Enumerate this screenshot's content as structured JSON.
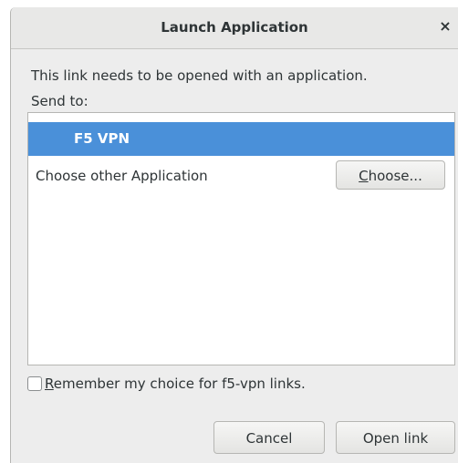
{
  "dialog": {
    "title": "Launch Application",
    "close_glyph": "×",
    "message": "This link needs to be opened with an application.",
    "send_to_label": "Send to:"
  },
  "app_list": {
    "selected_app": "F5 VPN",
    "other_label": "Choose other Application",
    "choose_button": {
      "mnemonic": "C",
      "rest": "hoose..."
    }
  },
  "remember": {
    "checked": false,
    "mnemonic": "R",
    "rest": "emember my choice for f5-vpn links."
  },
  "footer": {
    "cancel_label": "Cancel",
    "open_label": "Open link"
  },
  "colors": {
    "selection": "#4a90d9",
    "dialog_bg": "#ededed",
    "text": "#2e3436"
  },
  "icons": {
    "close": "close-icon"
  }
}
